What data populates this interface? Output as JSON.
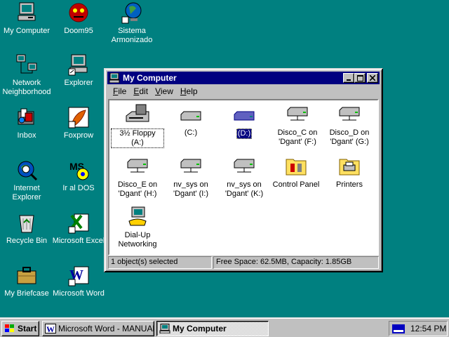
{
  "desktop": {
    "icons": [
      {
        "label": "My Computer",
        "icon": "computer-icon"
      },
      {
        "label": "Network Neighborhood",
        "icon": "network-icon"
      },
      {
        "label": "Inbox",
        "icon": "inbox-icon"
      },
      {
        "label": "Internet Explorer",
        "icon": "ie-globe-icon"
      },
      {
        "label": "Recycle Bin",
        "icon": "recycle-bin-icon"
      },
      {
        "label": "My Briefcase",
        "icon": "briefcase-icon"
      },
      {
        "label": "Doom95",
        "icon": "doom-icon"
      },
      {
        "label": "Explorer",
        "icon": "explorer-icon"
      },
      {
        "label": "Foxprow",
        "icon": "foxpro-icon"
      },
      {
        "label": "Ir al DOS",
        "icon": "msdos-icon"
      },
      {
        "label": "Microsoft Excel",
        "icon": "excel-icon"
      },
      {
        "label": "Microsoft Word",
        "icon": "word-icon"
      },
      {
        "label": "Sistema Armonizado",
        "icon": "globe-shortcut-icon"
      }
    ]
  },
  "window": {
    "title": "My Computer",
    "menu": [
      "File",
      "Edit",
      "View",
      "Help"
    ],
    "menu_underline": [
      "F",
      "E",
      "V",
      "H"
    ],
    "items": [
      {
        "label": "3½ Floppy (A:)",
        "icon": "floppy-drive-icon"
      },
      {
        "label": "(C:)",
        "icon": "hard-drive-icon"
      },
      {
        "label": "(D:)",
        "icon": "hard-drive-icon"
      },
      {
        "label": "Disco_C on 'Dgant' (F:)",
        "icon": "network-drive-icon"
      },
      {
        "label": "Disco_D on 'Dgant' (G:)",
        "icon": "network-drive-icon"
      },
      {
        "label": "Disco_E on 'Dgant' (H:)",
        "icon": "network-drive-icon"
      },
      {
        "label": "nv_sys on 'Dgant' (I:)",
        "icon": "network-drive-icon"
      },
      {
        "label": "nv_sys on 'Dgant' (K:)",
        "icon": "network-drive-icon"
      },
      {
        "label": "Control Panel",
        "icon": "control-panel-icon"
      },
      {
        "label": "Printers",
        "icon": "printers-icon"
      },
      {
        "label": "Dial-Up Networking",
        "icon": "dialup-icon"
      }
    ],
    "selected_item": "(D:)",
    "status": {
      "selection": "1 object(s) selected",
      "space": "Free Space: 62.5MB,  Capacity: 1.85GB"
    }
  },
  "taskbar": {
    "start_label": "Start",
    "tasks": [
      {
        "label": "Microsoft Word - MANUAL...",
        "active": false
      },
      {
        "label": "My Computer",
        "active": true
      }
    ],
    "clock": "12:54 PM"
  },
  "colors": {
    "desktop": "#008080",
    "title_active": "#000080",
    "face": "#c0c0c0"
  }
}
